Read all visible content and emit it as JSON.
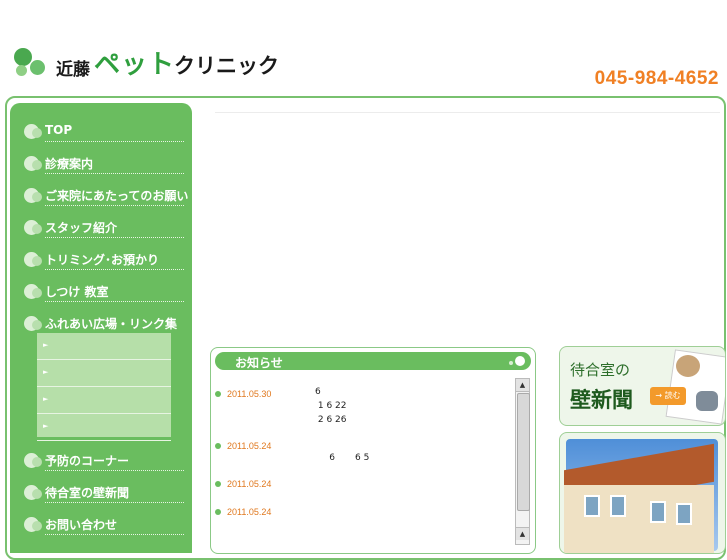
{
  "header": {
    "logo_kanji": "近藤",
    "logo_pet": "ペット",
    "logo_clinic": "クリニック",
    "phone": "045-984-4652"
  },
  "sidebar": {
    "items": [
      {
        "label": "TOP"
      },
      {
        "label": "診療案内"
      },
      {
        "label": "ご来院にあたってのお願い"
      },
      {
        "label": "スタッフ紹介"
      },
      {
        "label": "トリミング･お預かり"
      },
      {
        "label": "しつけ 教室"
      },
      {
        "label": "ふれあい広場・リンク集"
      },
      {
        "label": "予防のコーナー"
      },
      {
        "label": "待合室の壁新聞"
      },
      {
        "label": "お問い合わせ"
      }
    ],
    "subitems": [
      "",
      "",
      "",
      ""
    ],
    "sub_arrow": "►"
  },
  "news": {
    "title": "お知らせ",
    "items": [
      {
        "date": "2011.05.30",
        "body": "6\n 1 6 22\n 2 6 26"
      },
      {
        "date": "2011.05.24",
        "body": "\n     6       6 5"
      },
      {
        "date": "2011.05.24",
        "body": ""
      },
      {
        "date": "2011.05.24",
        "body": ""
      }
    ],
    "scroll_up": "▲",
    "scroll_down": "▲"
  },
  "banner": {
    "line1": "待合室の",
    "line2": "壁新聞",
    "read": "→ 読む"
  },
  "colors": {
    "brand_green": "#6abd5f",
    "accent_orange": "#f08024"
  }
}
